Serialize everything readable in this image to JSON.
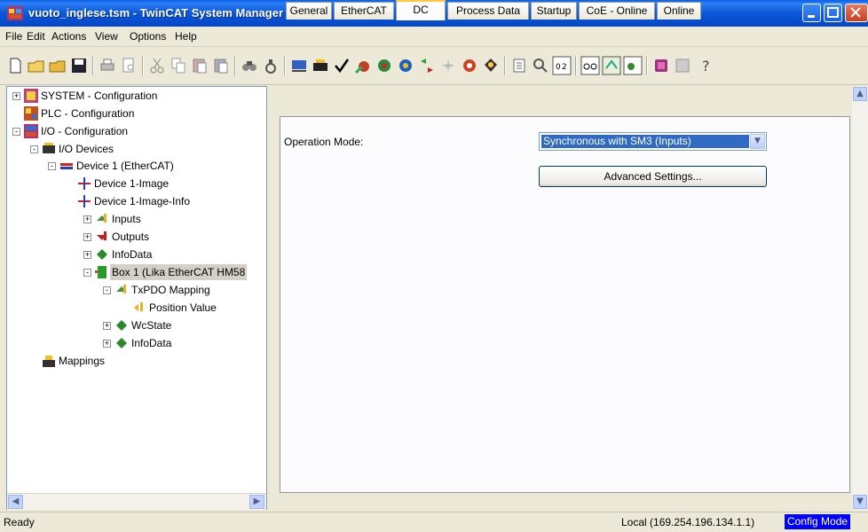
{
  "window": {
    "title": "vuoto_inglese.tsm - TwinCAT System Manager"
  },
  "menu": [
    "File",
    "Edit",
    "Actions",
    "View",
    "Options",
    "Help"
  ],
  "toolbar": {
    "buttons": [
      "new-icon",
      "open-icon",
      "open-folder-icon",
      "save-icon",
      "print-icon",
      "print-preview-icon",
      "cut-icon",
      "copy-icon",
      "paste-icon",
      "paste-special-icon",
      "find-icon",
      "find-next-icon",
      "device-icon",
      "insert-icon",
      "check-icon",
      "activate-icon",
      "restart-icon",
      "run-icon",
      "reload-icon",
      "mode-icon",
      "target-icon",
      "system-icon",
      "tree-icon",
      "zoom-icon",
      "variable-icon",
      "glasses-icon",
      "scan-icon",
      "mapping-icon",
      "book-icon",
      "info-icon",
      "help-icon"
    ]
  },
  "tree": {
    "items": [
      {
        "label": "SYSTEM - Configuration",
        "icon": "system-config-icon",
        "expander": "+"
      },
      {
        "label": "PLC - Configuration",
        "icon": "plc-config-icon",
        "expander": ""
      },
      {
        "label": "I/O - Configuration",
        "icon": "io-config-icon",
        "expander": "-"
      },
      {
        "label": "I/O Devices",
        "icon": "io-devices-icon",
        "expander": "-"
      },
      {
        "label": "Device 1 (EtherCAT)",
        "icon": "ethercat-device-icon",
        "expander": "-"
      },
      {
        "label": "Device 1-Image",
        "icon": "image-icon",
        "expander": ""
      },
      {
        "label": "Device 1-Image-Info",
        "icon": "image-info-icon",
        "expander": ""
      },
      {
        "label": "Inputs",
        "icon": "inputs-icon",
        "expander": "+"
      },
      {
        "label": "Outputs",
        "icon": "outputs-icon",
        "expander": "+"
      },
      {
        "label": "InfoData",
        "icon": "infodata-icon",
        "expander": "+"
      },
      {
        "label": "Box 1 (Lika EtherCAT HM58",
        "icon": "box-icon",
        "expander": "-"
      },
      {
        "label": "TxPDO Mapping",
        "icon": "txpdo-icon",
        "expander": "-"
      },
      {
        "label": "Position Value",
        "icon": "variable-icon",
        "expander": ""
      },
      {
        "label": "WcState",
        "icon": "wcstate-icon",
        "expander": "+"
      },
      {
        "label": "InfoData",
        "icon": "infodata-icon",
        "expander": "+"
      },
      {
        "label": "Mappings",
        "icon": "mappings-icon",
        "expander": ""
      }
    ]
  },
  "tabs": [
    "General",
    "EtherCAT",
    "DC",
    "Process Data",
    "Startup",
    "CoE - Online",
    "Online"
  ],
  "active_tab": "DC",
  "dc": {
    "operation_mode_label": "Operation Mode:",
    "operation_mode_value": "Synchronous with SM3 (Inputs)",
    "advanced_button": "Advanced Settings..."
  },
  "status": {
    "ready": "Ready",
    "local": "Local (169.254.196.134.1.1)",
    "mode": "Config Mode"
  },
  "colors": {
    "titlebar": "#0a58d8",
    "selection": "#316ac5",
    "config_mode_bg": "#0000ff",
    "active_tab_accent": "#ffc83c"
  }
}
